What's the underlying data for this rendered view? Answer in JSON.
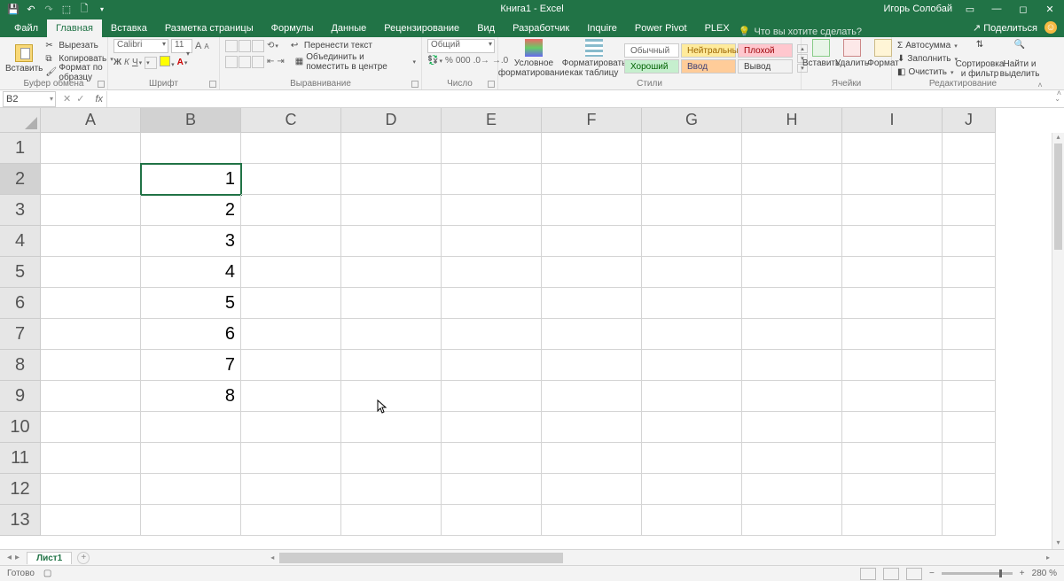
{
  "title": "Книга1 - Excel",
  "user": "Игорь Солобай",
  "tabs": {
    "file": "Файл",
    "home": "Главная",
    "insert": "Вставка",
    "layout": "Разметка страницы",
    "formulas": "Формулы",
    "data": "Данные",
    "review": "Рецензирование",
    "view": "Вид",
    "developer": "Разработчик",
    "inquire": "Inquire",
    "powerpivot": "Power Pivot",
    "plex": "PLEX",
    "tellme": "Что вы хотите сделать?",
    "share": "Поделиться"
  },
  "clipboard": {
    "paste": "Вставить",
    "cut": "Вырезать",
    "copy": "Копировать",
    "painter": "Формат по образцу",
    "label": "Буфер обмена"
  },
  "font": {
    "name": "Calibri",
    "size": "11",
    "label": "Шрифт",
    "bold": "Ж",
    "italic": "К",
    "underline": "Ч"
  },
  "align": {
    "wrap": "Перенести текст",
    "merge": "Объединить и поместить в центре",
    "label": "Выравнивание"
  },
  "number": {
    "format": "Общий",
    "label": "Число"
  },
  "styles": {
    "cond": "Условное форматирование",
    "table": "Форматировать как таблицу",
    "s1": "Обычный",
    "s2": "Нейтральный",
    "s3": "Плохой",
    "s4": "Хороший",
    "s5": "Ввод",
    "s6": "Вывод",
    "label": "Стили"
  },
  "cells": {
    "insert": "Вставить",
    "delete": "Удалить",
    "format": "Формат",
    "label": "Ячейки"
  },
  "editing": {
    "sum": "Автосумма",
    "fill": "Заполнить",
    "clear": "Очистить",
    "sort": "Сортировка и фильтр",
    "find": "Найти и выделить",
    "label": "Редактирование"
  },
  "namebox": "B2",
  "columns": [
    "A",
    "B",
    "C",
    "D",
    "E",
    "F",
    "G",
    "H",
    "I",
    "J"
  ],
  "rows": [
    "1",
    "2",
    "3",
    "4",
    "5",
    "6",
    "7",
    "8",
    "9",
    "10",
    "11",
    "12",
    "13"
  ],
  "active_cell": {
    "row": 1,
    "col": 1
  },
  "data_cells": {
    "B2": "1",
    "B3": "2",
    "B4": "3",
    "B5": "4",
    "B6": "5",
    "B7": "6",
    "B8": "7",
    "B9": "8"
  },
  "sheet": "Лист1",
  "status": "Готово",
  "zoom": "280 %"
}
